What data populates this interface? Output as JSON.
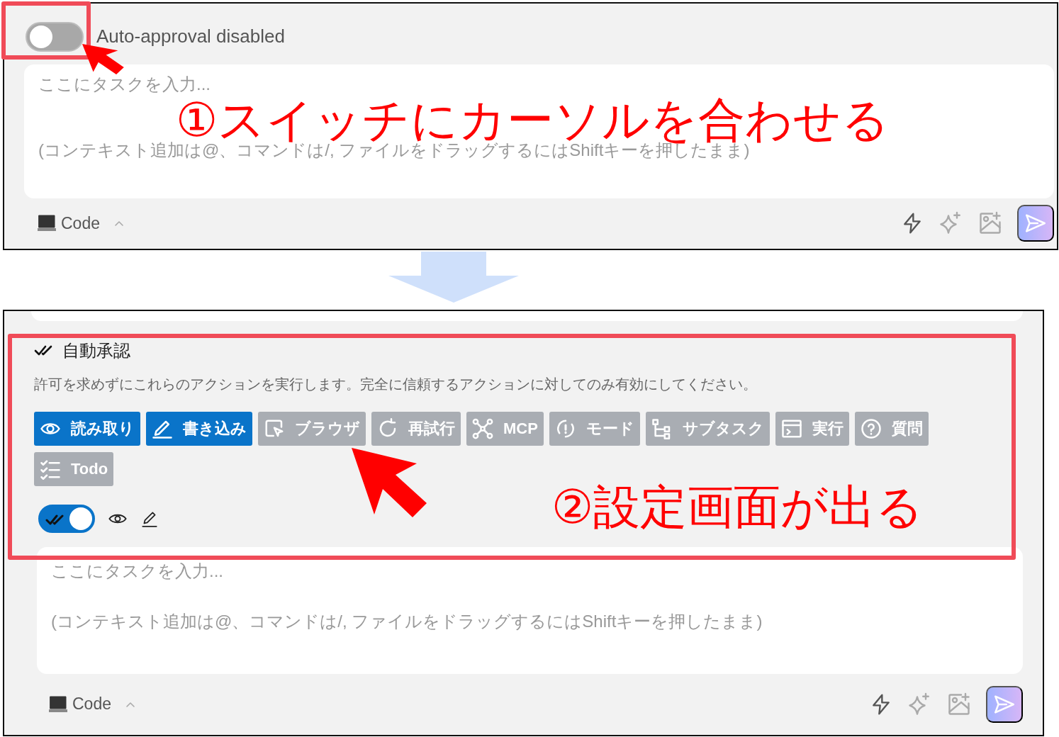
{
  "before": {
    "auto_approval": {
      "on": false,
      "label": "Auto-approval disabled"
    },
    "task_input": {
      "placeholder": "ここにタスクを入力...",
      "hint": "(コンテキスト追加は@、コマンドは/, ファイルをドラッグするにはShiftキーを押したまま)"
    },
    "mode_button": "Code"
  },
  "after": {
    "title": "自動承認",
    "description": "許可を求めずにこれらのアクションを実行します。完全に信頼するアクションに対してのみ有効にしてください。",
    "actions": [
      {
        "kind": "read",
        "label": "読み取り",
        "selected": true
      },
      {
        "kind": "write",
        "label": "書き込み",
        "selected": true
      },
      {
        "kind": "browser",
        "label": "ブラウザ",
        "selected": false
      },
      {
        "kind": "retry",
        "label": "再試行",
        "selected": false
      },
      {
        "kind": "mcp",
        "label": "MCP",
        "selected": false
      },
      {
        "kind": "mode",
        "label": "モード",
        "selected": false
      },
      {
        "kind": "subtask",
        "label": "サブタスク",
        "selected": false
      },
      {
        "kind": "execute",
        "label": "実行",
        "selected": false
      },
      {
        "kind": "question",
        "label": "質問",
        "selected": false
      },
      {
        "kind": "todo",
        "label": "Todo",
        "selected": false
      }
    ],
    "auto_approval": {
      "on": true
    },
    "task_input": {
      "placeholder": "ここにタスクを入力...",
      "hint": "(コンテキスト追加は@、コマンドは/, ファイルをドラッグするにはShiftキーを押したまま)"
    },
    "mode_button": "Code"
  },
  "annotations": [
    {
      "text": "①スイッチにカーソルを合わせる"
    },
    {
      "text": "②設定画面が出る"
    }
  ]
}
